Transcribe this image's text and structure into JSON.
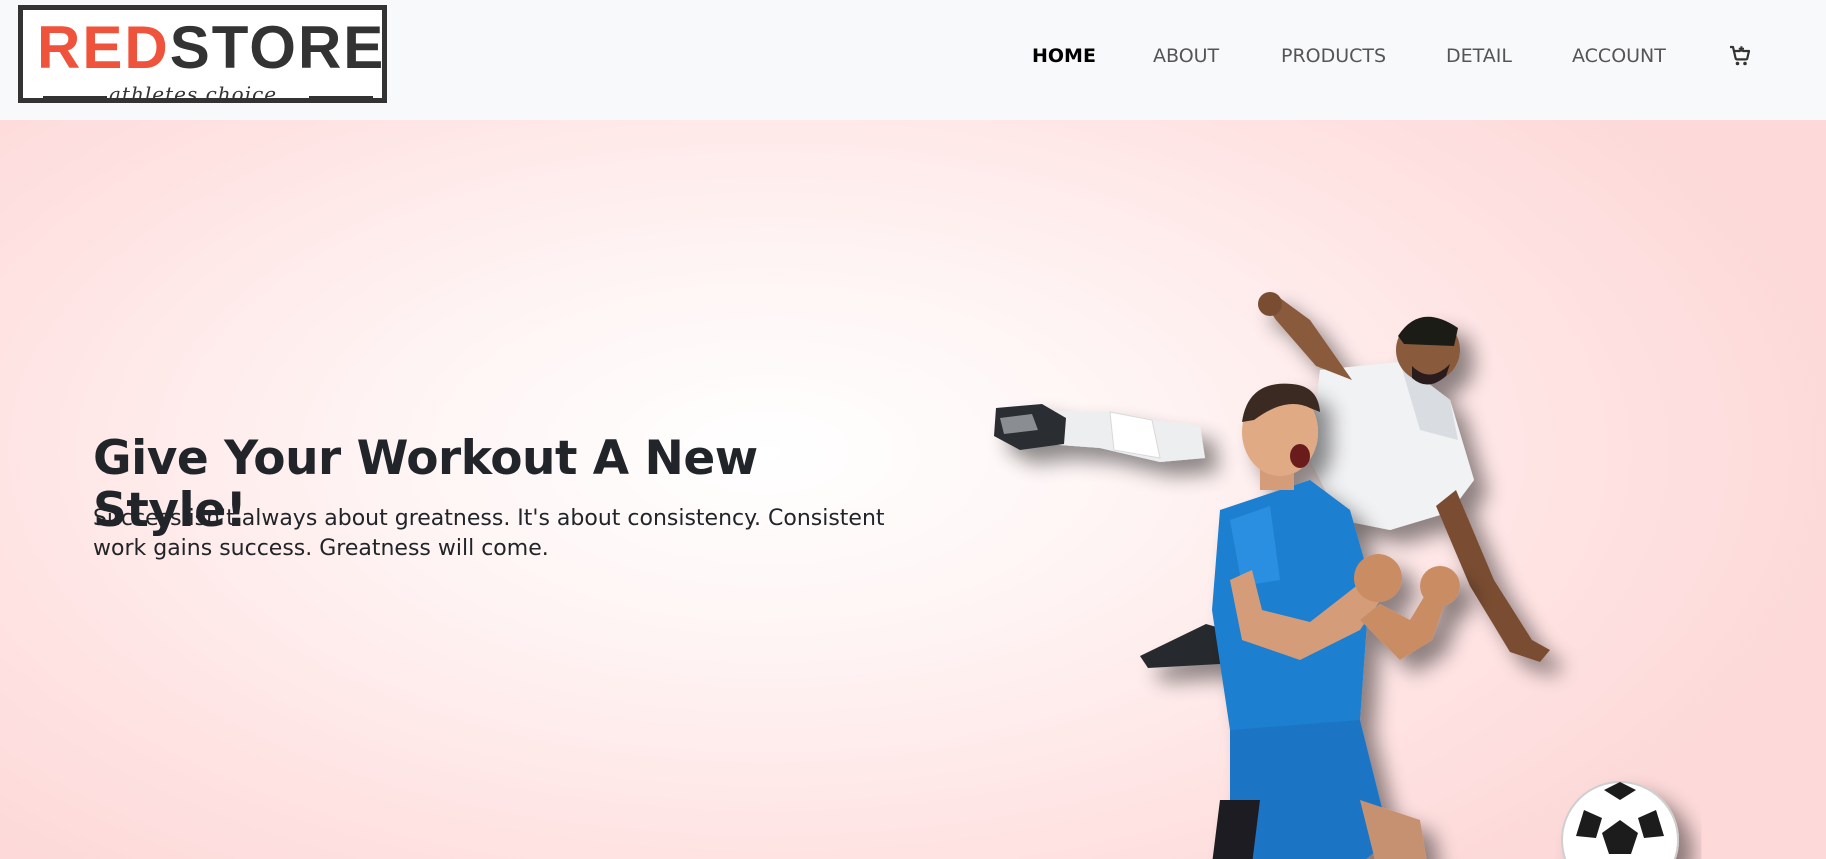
{
  "brand": {
    "word_red": "RED",
    "word_dark": "STORE",
    "tagline": "athletes choice",
    "colors": {
      "red": "#f0533b",
      "dark": "#333333"
    }
  },
  "nav": {
    "items": [
      {
        "label": "HOME",
        "active": true
      },
      {
        "label": "ABOUT",
        "active": false
      },
      {
        "label": "PRODUCTS",
        "active": false
      },
      {
        "label": "DETAIL",
        "active": false
      },
      {
        "label": "ACCOUNT",
        "active": false
      }
    ],
    "cart_icon": "cart-plus-icon"
  },
  "hero": {
    "title": "Give Your Workout A New Style!",
    "text": "Success isn't always about greatness. It's about consistency. Consistent work gains success. Greatness will come.",
    "image": "soccer-players-illustration",
    "background_colors": {
      "center": "#ffffff",
      "edge": "#fdd9d9"
    }
  }
}
